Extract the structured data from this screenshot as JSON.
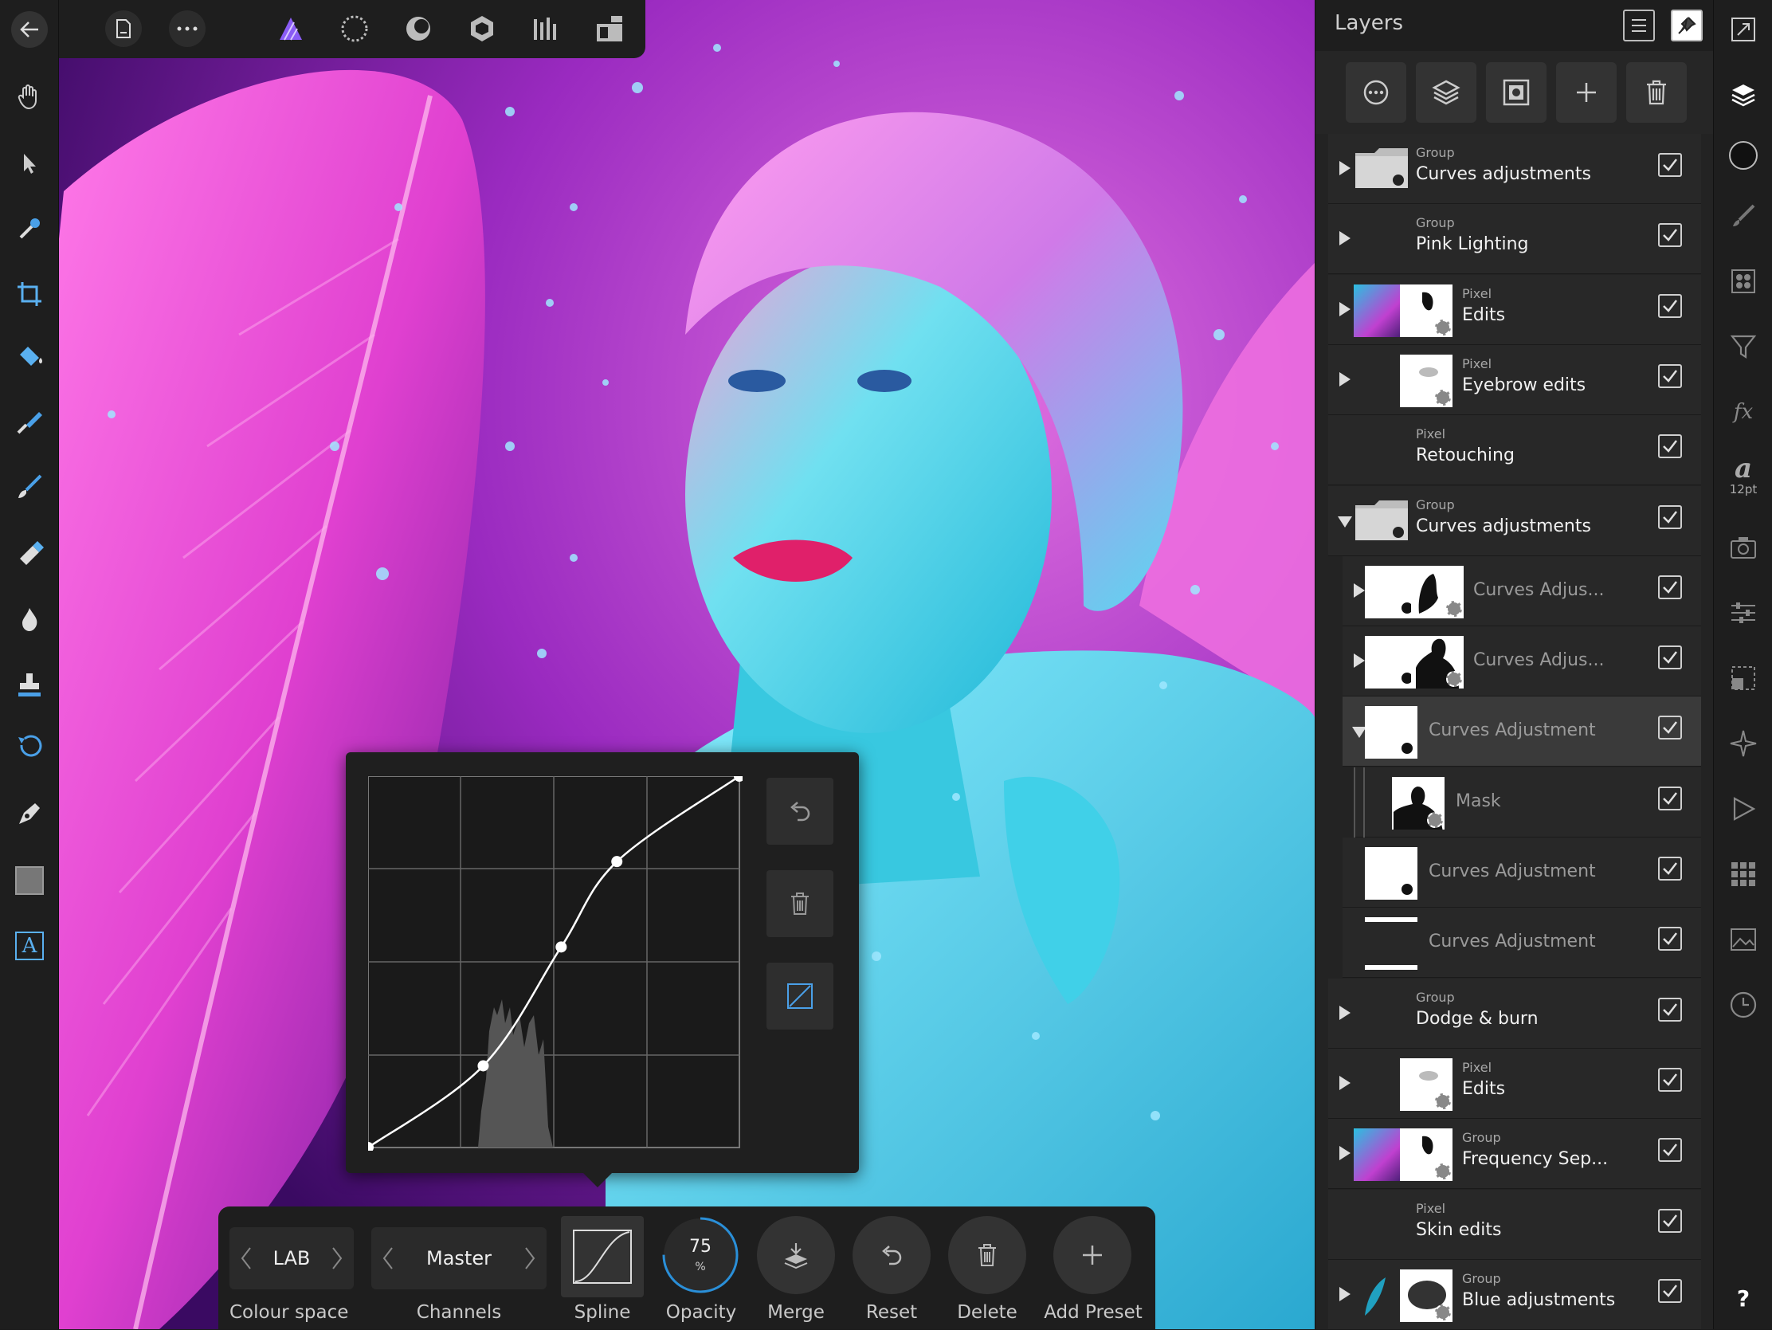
{
  "panel": {
    "title": "Layers"
  },
  "layers": [
    {
      "kind": "Group",
      "name": "Curves adjustments",
      "arrow": "right",
      "indent": 0,
      "thumb": "folder",
      "dim": false,
      "checked": true
    },
    {
      "kind": "Group",
      "name": "Pink Lighting",
      "arrow": "right",
      "indent": 0,
      "thumb": "none",
      "dim": false,
      "checked": true
    },
    {
      "kind": "Pixel",
      "name": "Edits",
      "arrow": "right",
      "indent": 0,
      "thumb": "photo+mask",
      "dim": false,
      "checked": true
    },
    {
      "kind": "Pixel",
      "name": "Eyebrow edits",
      "arrow": "right",
      "indent": 0,
      "thumb": "blank+mask",
      "dim": false,
      "checked": true
    },
    {
      "kind": "Pixel",
      "name": "Retouching",
      "arrow": "none",
      "indent": 0,
      "thumb": "none",
      "dim": false,
      "checked": true
    },
    {
      "kind": "Group",
      "name": "Curves adjustments",
      "arrow": "down",
      "indent": 0,
      "thumb": "folder",
      "dim": false,
      "checked": true
    },
    {
      "kind": "",
      "name": "Curves Adjus...",
      "arrow": "right",
      "indent": 1,
      "thumb": "adj+mask",
      "dim": true,
      "checked": true
    },
    {
      "kind": "",
      "name": "Curves Adjus...",
      "arrow": "right",
      "indent": 1,
      "thumb": "adj+mask2",
      "dim": true,
      "checked": true
    },
    {
      "kind": "",
      "name": "Curves Adjustment",
      "arrow": "down",
      "indent": 1,
      "thumb": "adj",
      "dim": true,
      "checked": true,
      "selected": true
    },
    {
      "kind": "",
      "name": "Mask",
      "arrow": "none",
      "indent": 2,
      "thumb": "mask",
      "dim": true,
      "checked": true
    },
    {
      "kind": "",
      "name": "Curves Adjustment",
      "arrow": "none",
      "indent": 1,
      "thumb": "adj",
      "dim": true,
      "checked": true
    },
    {
      "kind": "",
      "name": "Curves Adjustment",
      "arrow": "none",
      "indent": 1,
      "thumb": "adj-partial",
      "dim": true,
      "checked": true
    },
    {
      "kind": "Group",
      "name": "Dodge & burn",
      "arrow": "right",
      "indent": 0,
      "thumb": "none",
      "dim": false,
      "checked": true
    },
    {
      "kind": "Pixel",
      "name": "Edits",
      "arrow": "right",
      "indent": 0,
      "thumb": "blank+mask",
      "dim": false,
      "checked": true
    },
    {
      "kind": "Group",
      "name": "Frequency Sep...",
      "arrow": "right",
      "indent": 0,
      "thumb": "photo+mask",
      "dim": false,
      "checked": true
    },
    {
      "kind": "Pixel",
      "name": "Skin edits",
      "arrow": "none",
      "indent": 0,
      "thumb": "none",
      "dim": false,
      "checked": true
    },
    {
      "kind": "Group",
      "name": "Blue adjustments",
      "arrow": "right",
      "indent": 0,
      "thumb": "blue+blur",
      "dim": false,
      "checked": true
    }
  ],
  "right_bar": {
    "font_size_label": "12pt",
    "help_label": "?"
  },
  "context_bar": {
    "colour_space": {
      "value": "LAB",
      "label": "Colour space"
    },
    "channels": {
      "value": "Master",
      "label": "Channels"
    },
    "spline_label": "Spline",
    "opacity": {
      "value": "75",
      "unit": "%",
      "label": "Opacity",
      "level": 0.75
    },
    "merge_label": "Merge",
    "reset_label": "Reset",
    "delete_label": "Delete",
    "add_preset_label": "Add Preset"
  },
  "curve": {
    "points": [
      [
        0,
        0
      ],
      [
        0.31,
        0.22
      ],
      [
        0.52,
        0.54
      ],
      [
        0.67,
        0.77
      ],
      [
        1,
        1
      ]
    ]
  },
  "colors": {
    "accent_purple": "#8a5cf5",
    "opacity_ring": "#2a8fd8",
    "panel_bg": "#232323",
    "selected_row": "#3a3a3a"
  },
  "icons": {
    "left_tools": [
      "hand-icon",
      "move-icon",
      "color-picker-icon",
      "crop-icon",
      "fill-icon",
      "selection-brush-icon",
      "paint-brush-icon",
      "erase-brush-icon",
      "dodge-icon",
      "clone-icon",
      "undo-brush-icon",
      "pen-icon",
      "rectangle-shape-icon",
      "text-icon"
    ],
    "top_tools": [
      "back-icon",
      "document-icon",
      "more-icon",
      "photo-persona-icon",
      "liquify-persona-icon",
      "develop-persona-icon",
      "tone-map-persona-icon",
      "export-persona-icon",
      "view-mode-icon"
    ]
  }
}
